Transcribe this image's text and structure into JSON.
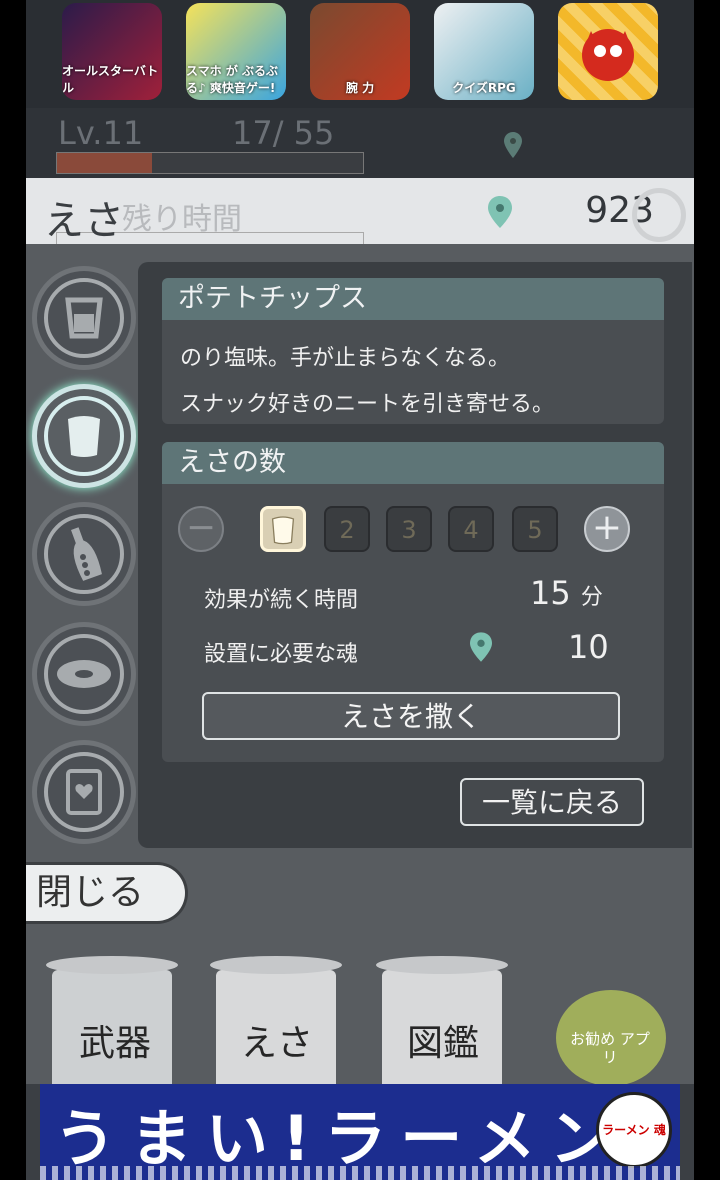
{
  "ad_apps": [
    {
      "name": "spider-app",
      "text": "オールスターバトル",
      "color": "#4b2a4e"
    },
    {
      "name": "anime-app",
      "text": "スマホ が ぶるぶる♪ 爽快音ゲー!",
      "color": "#4aa6d9"
    },
    {
      "name": "warrior-app",
      "text": "腕 力",
      "color": "#b3301f"
    },
    {
      "name": "cat-quiz-app",
      "text": "クイズRPG",
      "color": "#d8dde2"
    },
    {
      "name": "red-monster-app",
      "text": "",
      "color": "#f3b82a"
    }
  ],
  "level": {
    "label": "Lv.11",
    "exp": "17/   55",
    "exp_progress": 0.31
  },
  "esa_bar": {
    "title": "えさ",
    "ghost_text": "残り時間",
    "soul_count": "923"
  },
  "tabs": [
    {
      "name": "tab-cup",
      "icon": "cup-icon",
      "active": false
    },
    {
      "name": "tab-chips",
      "icon": "chips-bag-icon",
      "active": true
    },
    {
      "name": "tab-bottle",
      "icon": "bottle-icon",
      "active": false
    },
    {
      "name": "tab-disc",
      "icon": "disc-icon",
      "active": false
    },
    {
      "name": "tab-card",
      "icon": "heart-card-icon",
      "active": false
    }
  ],
  "item": {
    "title": "ポテトチップス",
    "desc_line1": "のり塩味。手が止まらなくなる。",
    "desc_line2": "スナック好きのニートを引き寄せる。"
  },
  "quantity": {
    "title": "えさの数",
    "minus": "−",
    "plus": "+",
    "options": [
      "",
      "2",
      "3",
      "4",
      "5"
    ],
    "selected": 1
  },
  "effect": {
    "label": "効果が続く時間",
    "value": "15",
    "unit": "分"
  },
  "cost": {
    "label": "設置に必要な魂",
    "value": "10"
  },
  "scatter_button": "えさを撒く",
  "back_button": "一覧に戻る",
  "close_button": "閉じる",
  "bottom_nav": {
    "weapon": "武器",
    "esa": "えさ",
    "catalog": "図鑑",
    "recommend": "お勧め アプリ"
  },
  "ad_banner": {
    "text": "うまい!ラーメン",
    "logo": "ラーメン 魂"
  },
  "colors": {
    "accent": "#5e7577",
    "soul_pin": "#7fc3b3",
    "selected_box": "#d9cfb4",
    "ad_blue": "#1c2d8f"
  }
}
